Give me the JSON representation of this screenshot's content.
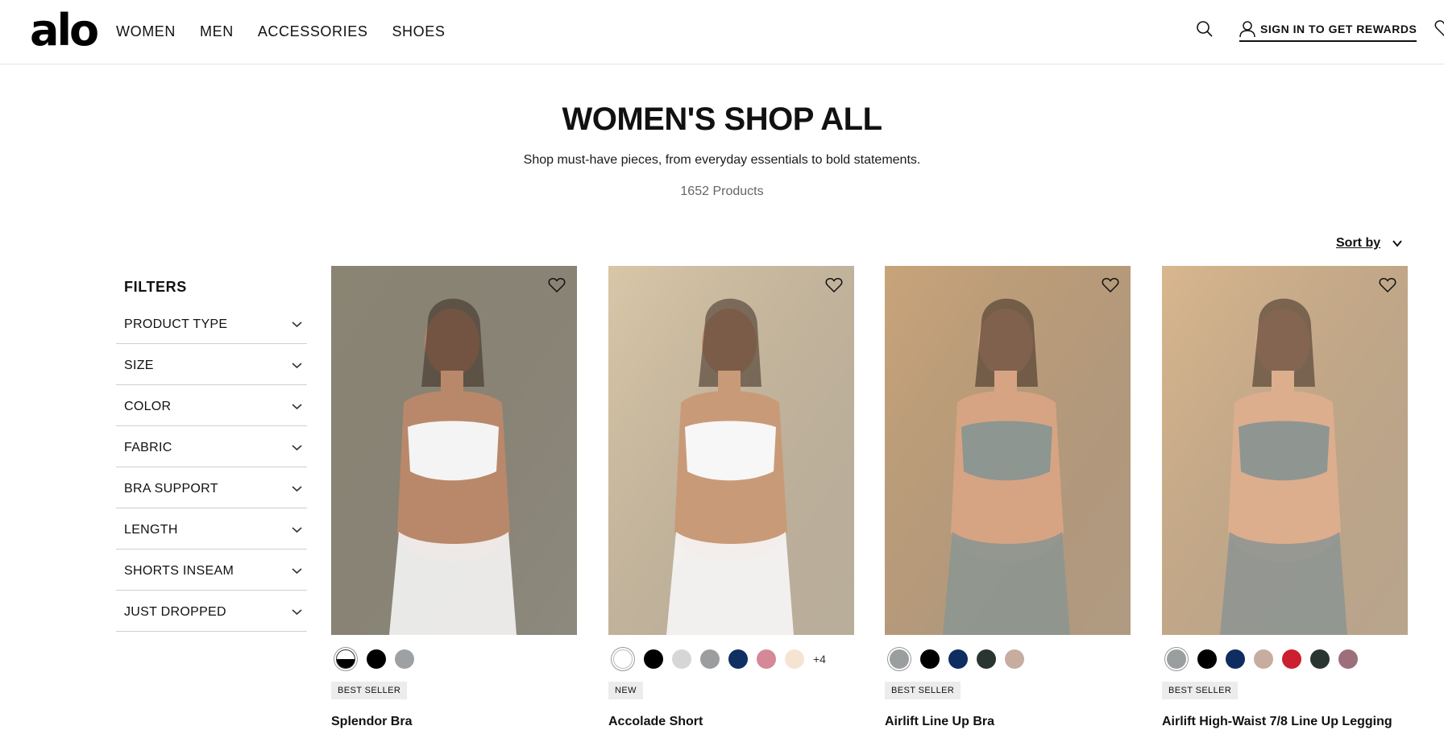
{
  "header": {
    "logo": "alo",
    "nav": [
      "WOMEN",
      "MEN",
      "ACCESSORIES",
      "SHOES"
    ],
    "signin_label": "SIGN IN TO GET REWARDS"
  },
  "page": {
    "title": "WOMEN'S SHOP ALL",
    "subtitle": "Shop must-have pieces, from everyday essentials to bold statements.",
    "product_count": "1652 Products",
    "sort_label": "Sort by"
  },
  "filters": {
    "heading": "FILTERS",
    "items": [
      "PRODUCT TYPE",
      "SIZE",
      "COLOR",
      "FABRIC",
      "BRA SUPPORT",
      "LENGTH",
      "SHORTS INSEAM",
      "JUST DROPPED"
    ]
  },
  "products": [
    {
      "name": "Splendor Bra",
      "badge": "BEST SELLER",
      "swatches": [
        "#ffffff",
        "#000000",
        "#9ea1a3"
      ],
      "more": "",
      "image_colors": {
        "bg": "#8a8573",
        "skin": "#b9886a",
        "garment": "#f4f4f4"
      }
    },
    {
      "name": "Accolade Short",
      "badge": "NEW",
      "swatches": [
        "#ffffff",
        "#000000",
        "#d6d6d6",
        "#9b9d9f",
        "#102f62",
        "#d58898",
        "#f6e4d2"
      ],
      "more": "+4",
      "image_colors": {
        "bg": "#d9c7a8",
        "skin": "#c99a78",
        "garment": "#f7f7f7"
      }
    },
    {
      "name": "Airlift Line Up Bra",
      "badge": "BEST SELLER",
      "swatches": [
        "#9a9e9f",
        "#000000",
        "#0f2d60",
        "#2a3431",
        "#c7ada0"
      ],
      "more": "",
      "image_colors": {
        "bg": "#c9a47a",
        "skin": "#d6a483",
        "garment": "#8d9690"
      }
    },
    {
      "name": "Airlift High-Waist 7/8 Line Up Legging",
      "badge": "BEST SELLER",
      "swatches": [
        "#9a9e9f",
        "#000000",
        "#0f2d60",
        "#c7ada0",
        "#cc1f2f",
        "#2a3431",
        "#9c6f7a"
      ],
      "more": "",
      "image_colors": {
        "bg": "#d8b78e",
        "skin": "#dcae8d",
        "garment": "#8f9692"
      }
    }
  ]
}
